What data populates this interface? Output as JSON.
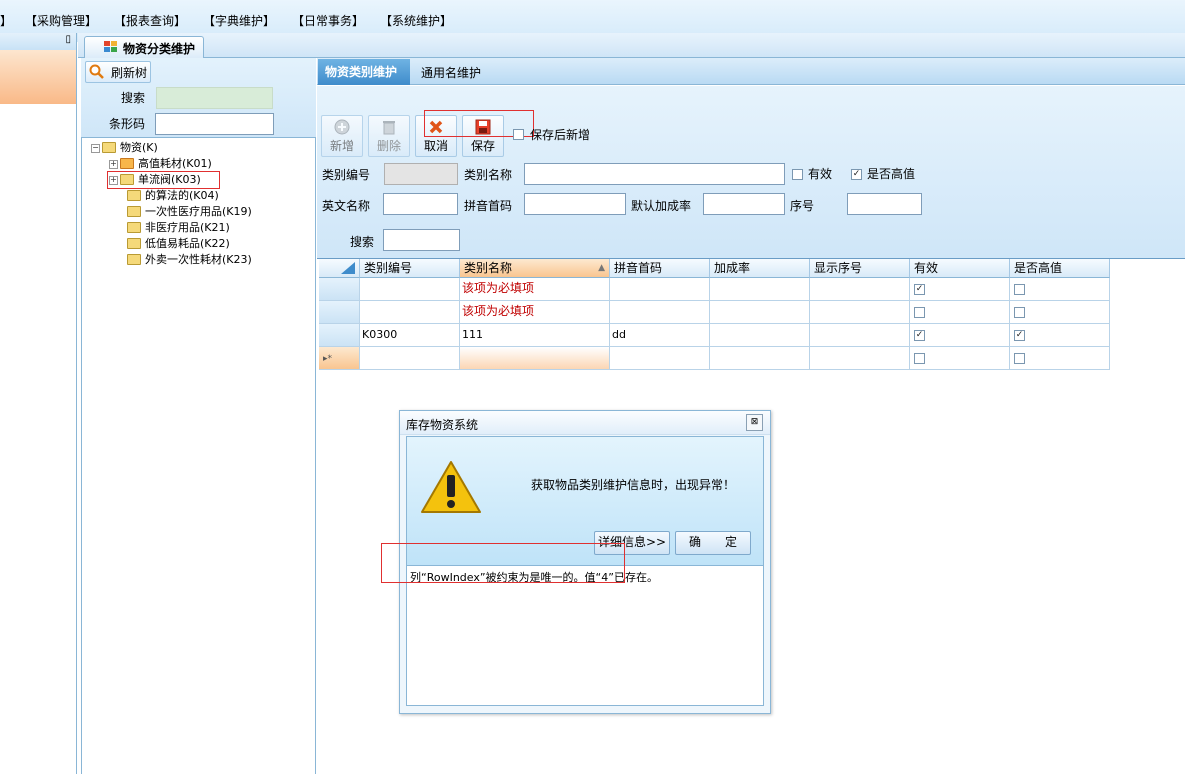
{
  "menubar": {
    "items": [
      "】",
      "【采购管理】",
      "【报表查询】",
      "【字典维护】",
      "【日常事务】",
      "【系统维护】"
    ]
  },
  "left_pane": {
    "pin_glyph": "ꟸ"
  },
  "doc_tab": {
    "label": "物资分类维护"
  },
  "tree_panel": {
    "refresh_label": "刷新树",
    "search_label": "搜索",
    "barcode_label": "条形码",
    "search_value": "",
    "barcode_value": "",
    "nodes": [
      {
        "label": "物资(K)",
        "expander": "−"
      },
      {
        "label": "高值耗材(K01)",
        "expander": "+"
      },
      {
        "label": "单流阀(K03)",
        "expander": "+"
      },
      {
        "label": "的算法的(K04)",
        "expander": ""
      },
      {
        "label": "一次性医疗用品(K19)",
        "expander": ""
      },
      {
        "label": "非医疗用品(K21)",
        "expander": ""
      },
      {
        "label": "低值易耗品(K22)",
        "expander": ""
      },
      {
        "label": "外卖一次性耗材(K23)",
        "expander": ""
      }
    ]
  },
  "sub_tabs": [
    "物资类别维护",
    "通用名维护"
  ],
  "toolbar": {
    "add_label": "新增",
    "delete_label": "删除",
    "cancel_label": "取消",
    "save_label": "保存",
    "save_then_new_label": "保存后新增"
  },
  "form": {
    "code_label": "类别编号",
    "name_label": "类别名称",
    "valid_label": "有效",
    "high_value_label": "是否高值",
    "en_name_label": "英文名称",
    "pinyin_label": "拼音首码",
    "markup_label": "默认加成率",
    "seq_label": "序号",
    "search_label": "搜索",
    "valid_checked": false,
    "high_value_checked": true
  },
  "grid": {
    "columns": [
      "类别编号",
      "类别名称",
      "拼音首码",
      "加成率",
      "显示序号",
      "有效",
      "是否高值"
    ],
    "rows": [
      {
        "code": "",
        "name": "该项为必填项",
        "pinyin": "",
        "markup": "",
        "seq": "",
        "valid": true,
        "high": false
      },
      {
        "code": "",
        "name": "该项为必填项",
        "pinyin": "",
        "markup": "",
        "seq": "",
        "valid": false,
        "high": false
      },
      {
        "code": "K0300",
        "name": "111",
        "pinyin": "dd",
        "markup": "",
        "seq": "",
        "valid": true,
        "high": true
      },
      {
        "code": "",
        "name": "",
        "pinyin": "",
        "markup": "",
        "seq": "",
        "valid": false,
        "high": false
      }
    ],
    "new_row_marker": "▸*"
  },
  "dialog": {
    "title": "库存物资系统",
    "message": "获取物品类别维护信息时，出现异常！",
    "details_button": "详细信息>>",
    "ok_button": "确　　定",
    "detail_text": "列“RowIndex”被约束为是唯一的。值“4”已存在。",
    "close_glyph": "⊠"
  },
  "colors": {
    "accent": "#3f8ccb",
    "required_text": "#c00000",
    "highlight_box": "#e03030"
  }
}
